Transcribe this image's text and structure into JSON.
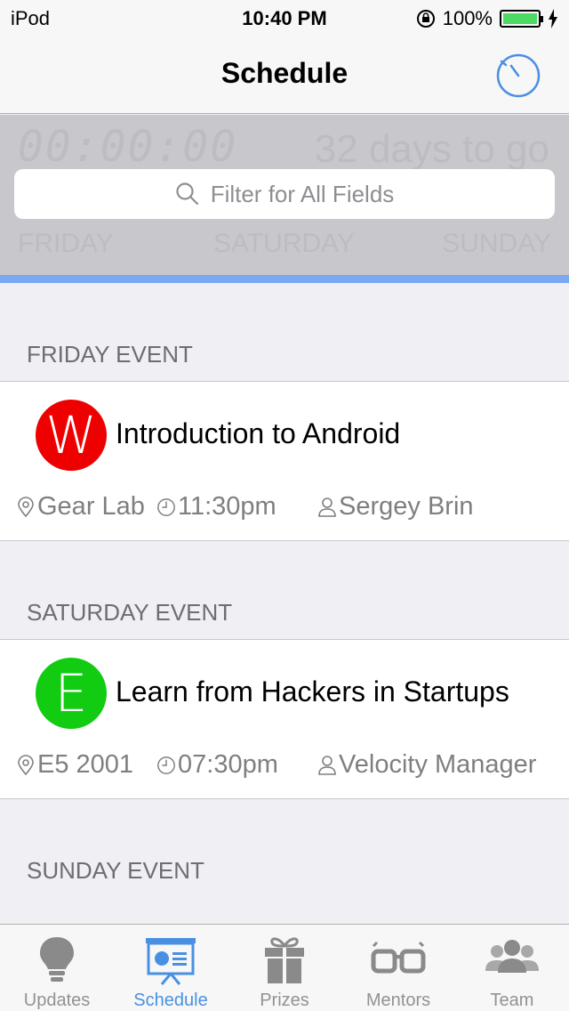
{
  "status_bar": {
    "device": "iPod",
    "time": "10:40 PM",
    "battery": "100%"
  },
  "navbar": {
    "title": "Schedule"
  },
  "header": {
    "countdown": "00:00:00",
    "days_to_go": "32 days to go",
    "days": [
      "FRIDAY",
      "SATURDAY",
      "SUNDAY"
    ]
  },
  "search": {
    "placeholder": "Filter for All Fields"
  },
  "sections": [
    {
      "header": "FRIDAY EVENT",
      "event": {
        "avatar_letter": "W",
        "avatar_color": "#ee0000",
        "title": "Introduction to Android",
        "location": "Gear Lab",
        "time": "11:30pm",
        "speaker": "Sergey Brin"
      }
    },
    {
      "header": "SATURDAY EVENT",
      "event": {
        "avatar_letter": "E",
        "avatar_color": "#12cc12",
        "title": "Learn from Hackers in Startups",
        "location": "E5 2001",
        "time": "07:30pm",
        "speaker": "Velocity Manager"
      }
    },
    {
      "header": "SUNDAY EVENT"
    }
  ],
  "tabbar": {
    "active": "Schedule",
    "tabs": [
      {
        "label": "Updates",
        "icon": "lightbulb-icon"
      },
      {
        "label": "Schedule",
        "icon": "presentation-board-icon"
      },
      {
        "label": "Prizes",
        "icon": "gift-icon"
      },
      {
        "label": "Mentors",
        "icon": "glasses-icon"
      },
      {
        "label": "Team",
        "icon": "people-icon"
      }
    ]
  },
  "colors": {
    "accent": "#4a90e2",
    "strip": "#7aa8f5"
  }
}
